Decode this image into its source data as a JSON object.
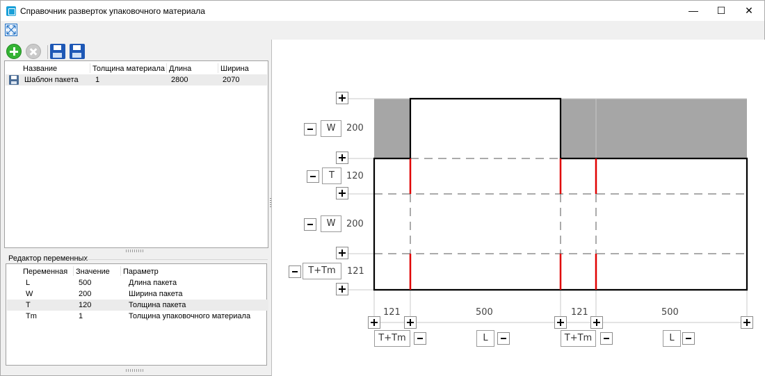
{
  "window": {
    "title": "Справочник разверток упаковочного материала",
    "controls": {
      "minimize": "—",
      "maximize": "☐",
      "close": "✕"
    }
  },
  "templates": {
    "columns": [
      "Название",
      "Толщина материала",
      "Длина",
      "Ширина"
    ],
    "rows": [
      {
        "name": "Шаблон пакета",
        "thickness": "1",
        "length": "2800",
        "width": "2070"
      }
    ]
  },
  "variables": {
    "group_title": "Редактор переменных",
    "columns": [
      "Переменная",
      "Значение",
      "Параметр"
    ],
    "rows": [
      {
        "var": "L",
        "value": "500",
        "param": "Длина пакета"
      },
      {
        "var": "W",
        "value": "200",
        "param": "Ширина пакета"
      },
      {
        "var": "T",
        "value": "120",
        "param": "Толщина пакета"
      },
      {
        "var": "Tm",
        "value": "1",
        "param": "Толщина упаковочного материала"
      }
    ]
  },
  "drawing": {
    "row_labels": [
      {
        "var": "W",
        "value": "200"
      },
      {
        "var": "T",
        "value": "120"
      },
      {
        "var": "W",
        "value": "200"
      },
      {
        "var": "T+Tm",
        "value": "121"
      }
    ],
    "col_labels": [
      {
        "var": "T+Tm",
        "value": "121"
      },
      {
        "var": "L",
        "value": "500"
      },
      {
        "var": "T+Tm",
        "value": "121"
      },
      {
        "var": "L",
        "value": "500"
      }
    ],
    "colors": {
      "flap": "#a6a6a6",
      "fold": "#e00000",
      "outline": "#000000",
      "guide": "#c0c0c0"
    }
  }
}
